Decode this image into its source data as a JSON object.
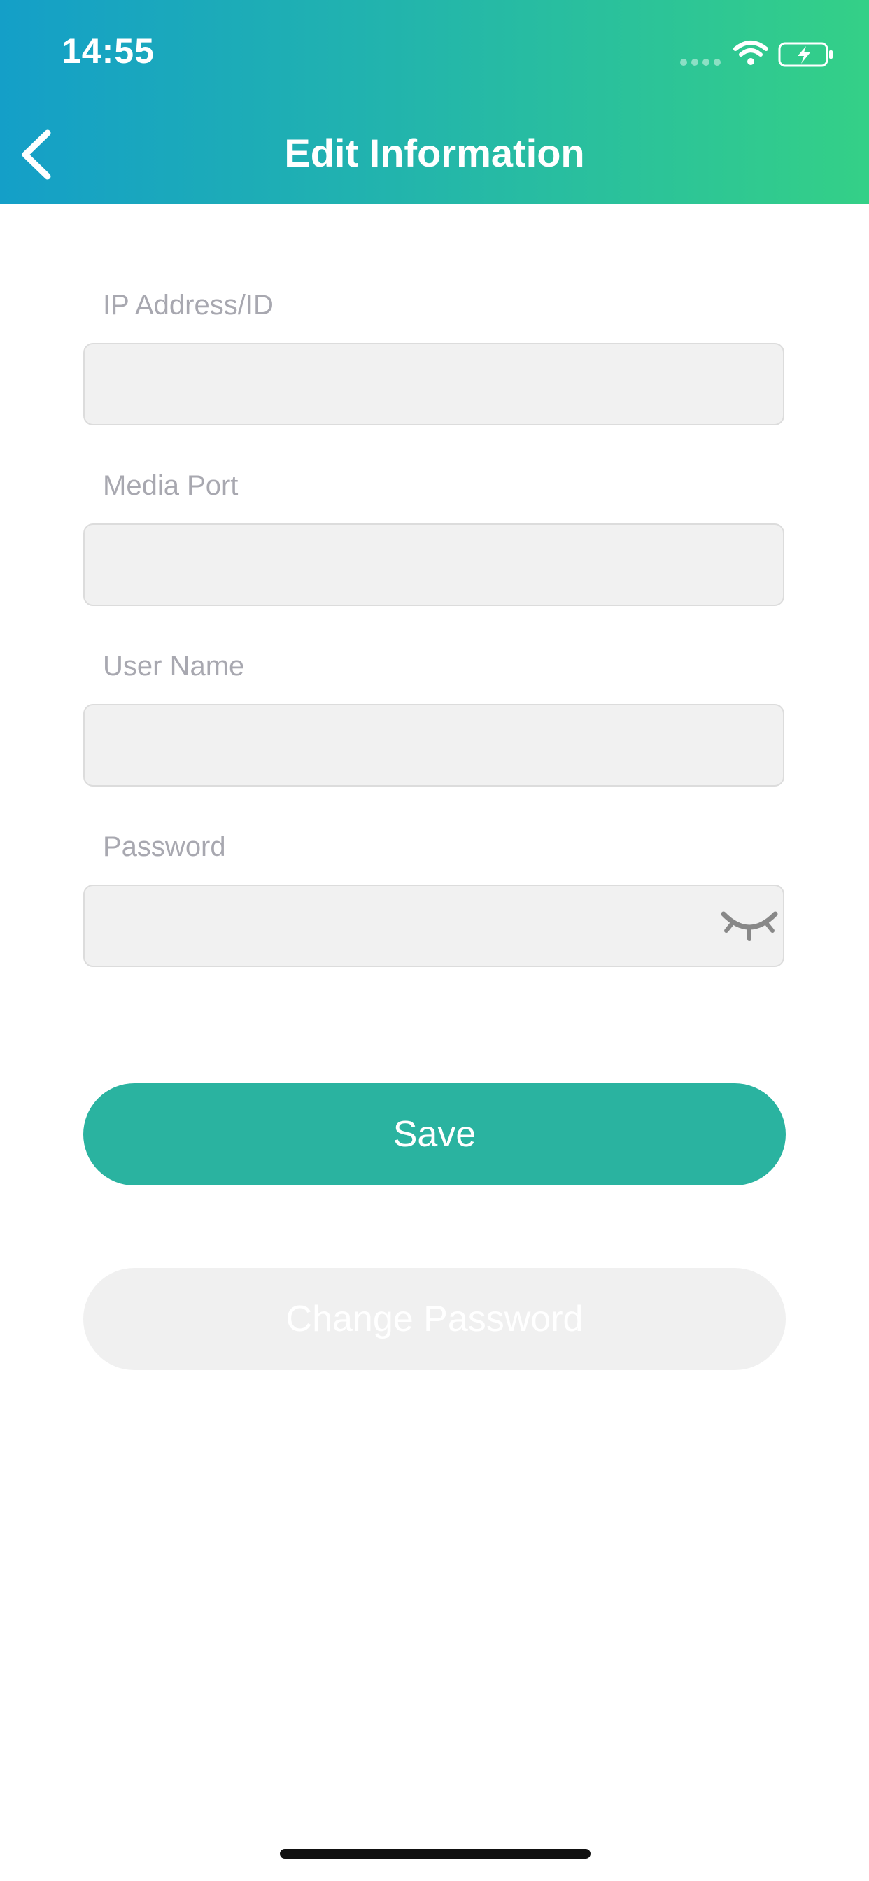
{
  "status_bar": {
    "time": "14:55"
  },
  "nav": {
    "title": "Edit Information",
    "back_icon": "chevron-left-icon"
  },
  "form": {
    "ip_label": "IP Address/ID",
    "ip_value": "",
    "port_label": "Media Port",
    "port_value": "",
    "username_label": "User Name",
    "username_value": "",
    "password_label": "Password",
    "password_value": "",
    "password_toggle_icon": "eye-closed-icon"
  },
  "actions": {
    "save_label": "Save",
    "change_password_label": "Change Password"
  },
  "colors": {
    "header_start": "#149fc8",
    "header_end": "#34d087",
    "primary": "#2ab3a0",
    "input_bg": "#f1f1f1",
    "label": "#a8a8b0"
  }
}
